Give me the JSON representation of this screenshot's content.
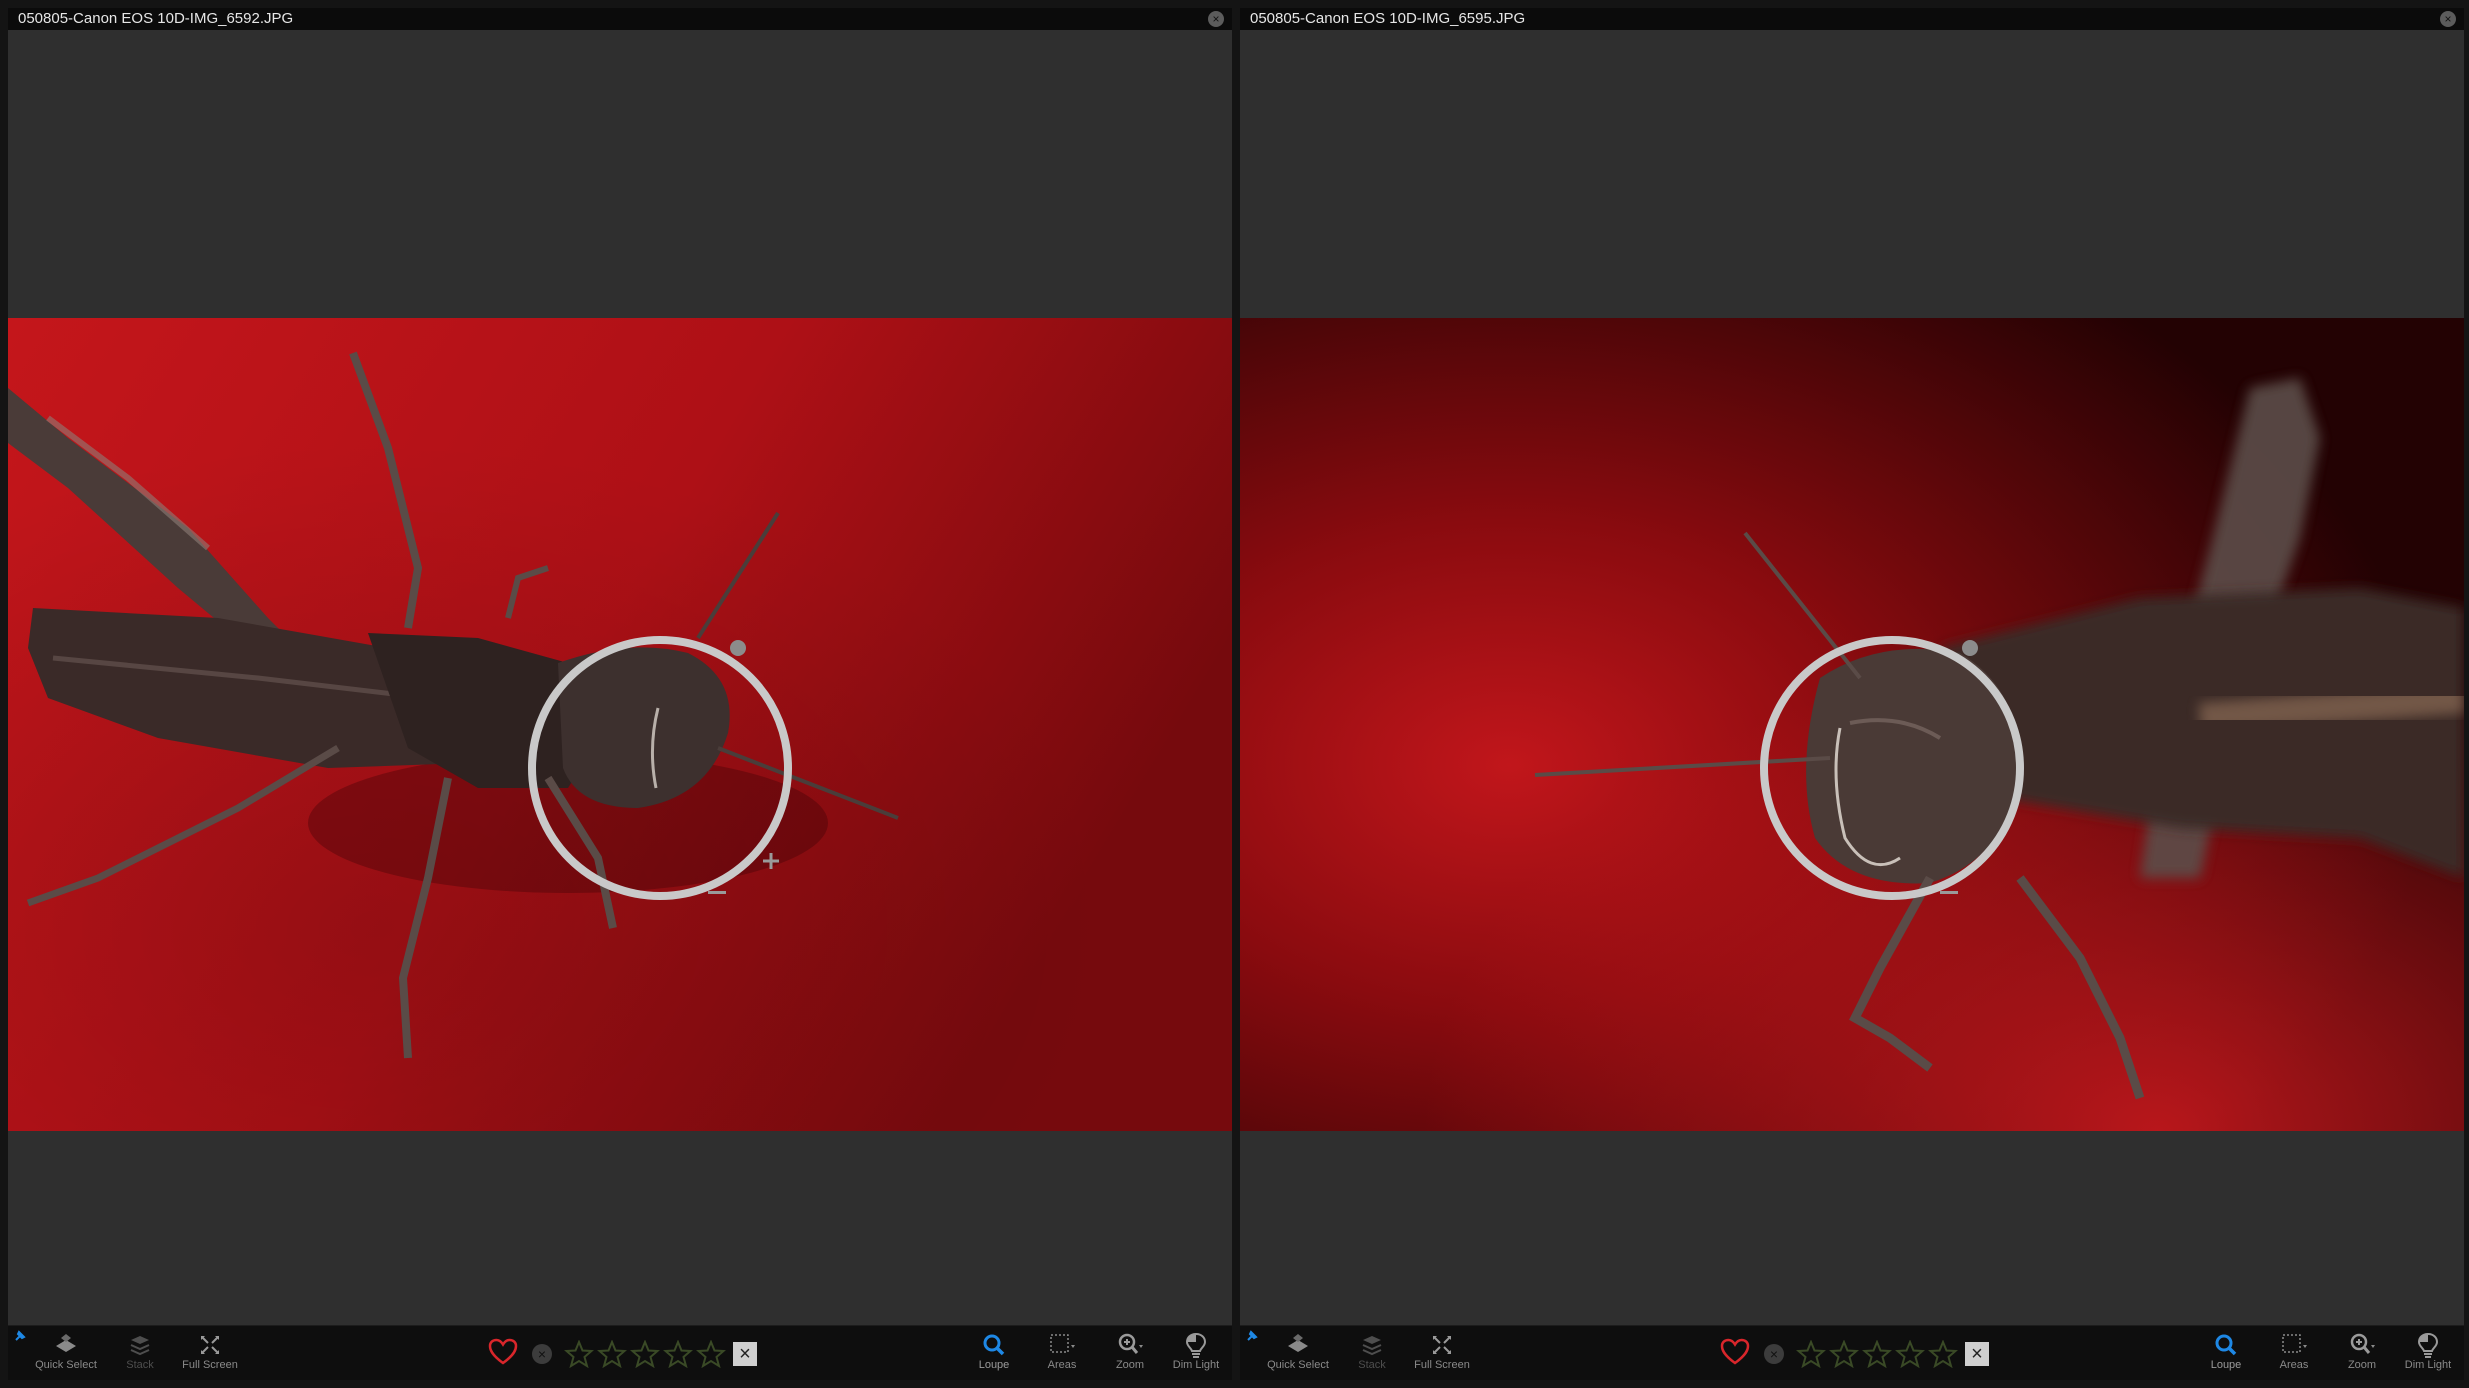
{
  "panes": [
    {
      "title": "050805-Canon EOS 10D-IMG_6592.JPG",
      "close_glyph": "×"
    },
    {
      "title": "050805-Canon EOS 10D-IMG_6595.JPG",
      "close_glyph": "×"
    }
  ],
  "toolbar": {
    "quick_select": "Quick Select",
    "stack": "Stack",
    "full_screen": "Full Screen",
    "loupe": "Loupe",
    "areas": "Areas",
    "zoom": "Zoom",
    "dim_light": "Dim Light",
    "reject_glyph": "×",
    "clear_glyph": "×"
  },
  "colors": {
    "accent": "#1e88e5",
    "heart": "#d9262b",
    "star_outline": "#3a4a26"
  }
}
